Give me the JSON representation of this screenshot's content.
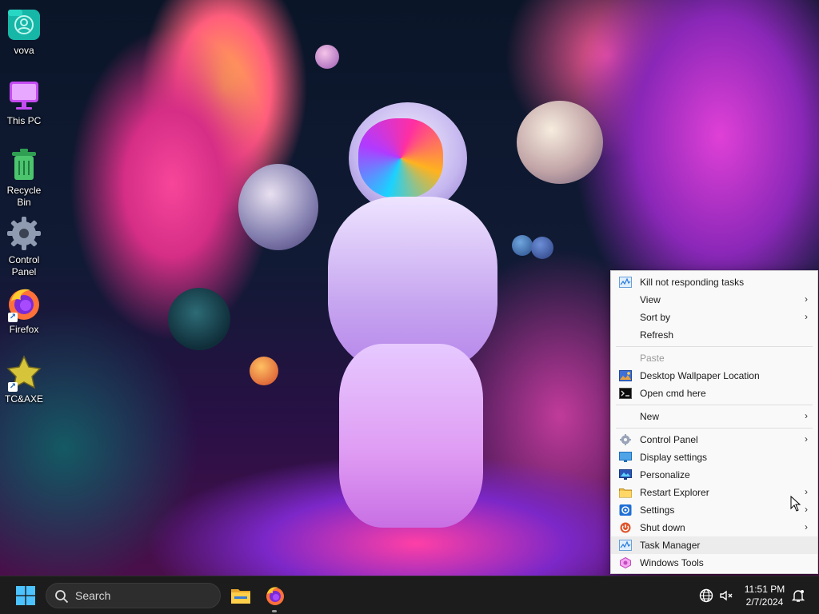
{
  "desktop": {
    "icons": [
      {
        "label": "vova",
        "icon": "user-folder-icon"
      },
      {
        "label": "This PC",
        "icon": "monitor-icon"
      },
      {
        "label": "Recycle Bin",
        "icon": "recycle-bin-icon"
      },
      {
        "label": "Control Panel",
        "icon": "gear-icon"
      },
      {
        "label": "Firefox",
        "icon": "firefox-icon"
      },
      {
        "label": "TC&AXE",
        "icon": "star-icon"
      }
    ]
  },
  "context_menu": {
    "items": [
      {
        "label": "Kill not responding tasks",
        "icon": "task-manager-icon"
      },
      {
        "label": "View",
        "submenu": true
      },
      {
        "label": "Sort by",
        "submenu": true
      },
      {
        "label": "Refresh"
      },
      {
        "label": "Paste",
        "disabled": true
      },
      {
        "label": "Desktop Wallpaper Location",
        "icon": "wallpaper-icon"
      },
      {
        "label": "Open cmd here",
        "icon": "cmd-icon"
      },
      {
        "label": "New",
        "submenu": true
      },
      {
        "label": "Control Panel",
        "icon": "control-panel-icon",
        "submenu": true
      },
      {
        "label": "Display settings",
        "icon": "display-icon"
      },
      {
        "label": "Personalize",
        "icon": "personalize-icon"
      },
      {
        "label": "Restart Explorer",
        "icon": "folder-icon",
        "submenu": true
      },
      {
        "label": "Settings",
        "icon": "settings-icon",
        "submenu": true
      },
      {
        "label": "Shut down",
        "icon": "power-icon",
        "submenu": true
      },
      {
        "label": "Task Manager",
        "icon": "task-manager-icon",
        "hovered": true
      },
      {
        "label": "Windows Tools",
        "icon": "windows-tools-icon"
      }
    ],
    "arrow": "›"
  },
  "taskbar": {
    "search_placeholder": "Search",
    "clock_time": "11:51 PM",
    "clock_date": "2/7/2024"
  },
  "colors": {
    "taskbar_bg": "#1c1c1c",
    "menu_bg": "#f9f9f9",
    "accent": "#0078d4"
  }
}
